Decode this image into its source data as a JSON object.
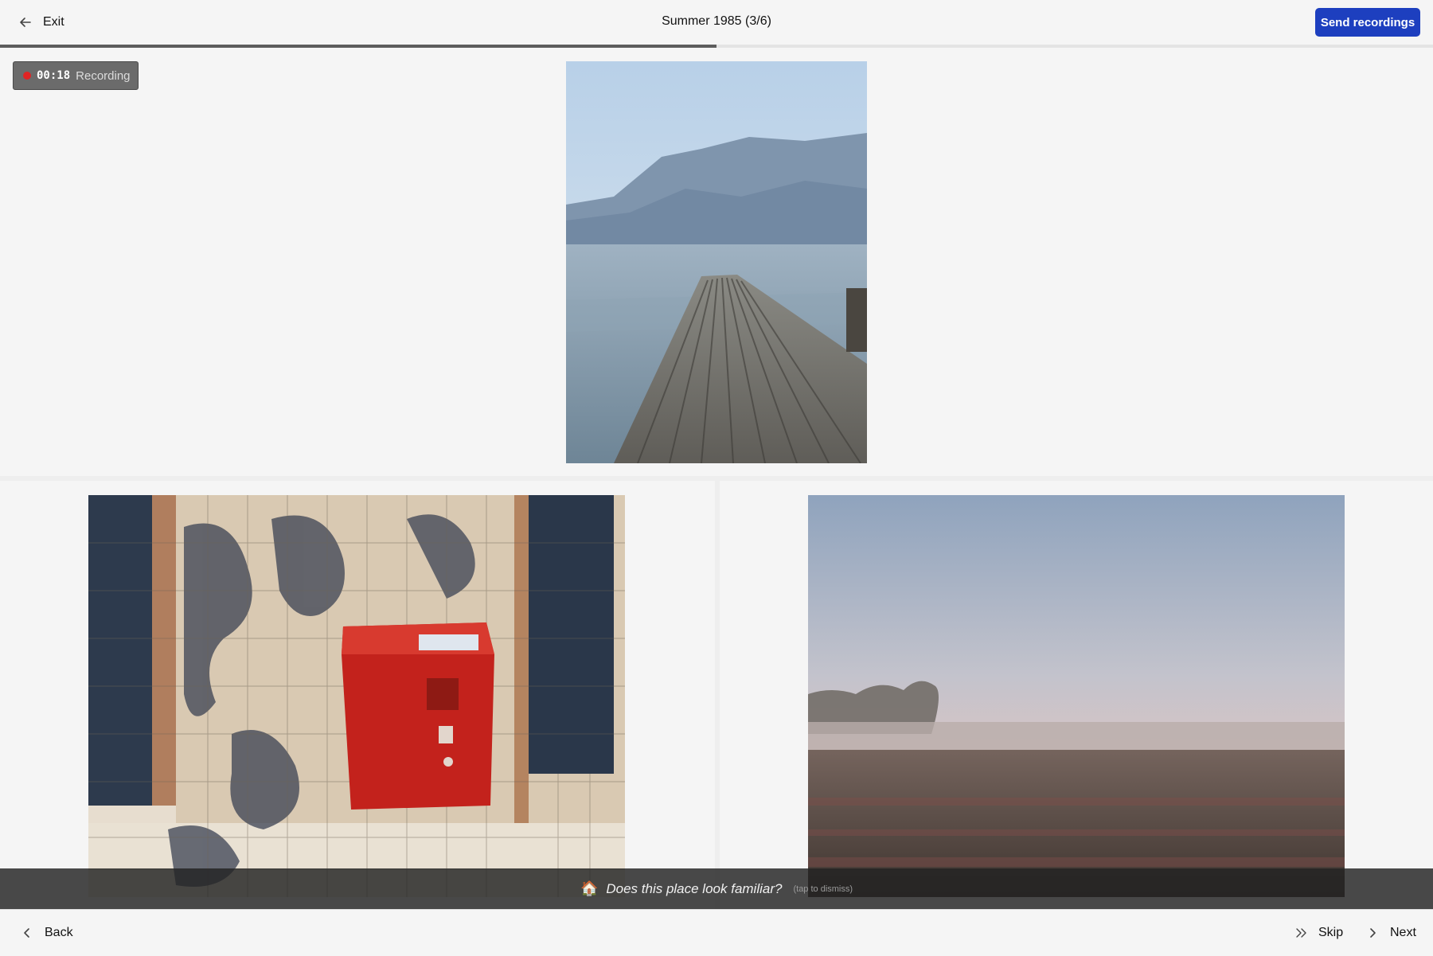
{
  "header": {
    "exit_label": "Exit",
    "title": "Summer 1985 (3/6)",
    "send_label": "Send recordings"
  },
  "progress": {
    "fraction": 0.5
  },
  "recording": {
    "time": "00:18",
    "label": "Recording",
    "indicator_color": "#e02424"
  },
  "photos": [
    {
      "description_name": "lake-dock-photo"
    },
    {
      "description_name": "red-mailbox-photo"
    },
    {
      "description_name": "misty-field-photo"
    }
  ],
  "prompt": {
    "icon": "🏠",
    "text": "Does this place look familiar?",
    "hint": "(tap to dismiss)"
  },
  "footer": {
    "back_label": "Back",
    "skip_label": "Skip",
    "next_label": "Next"
  },
  "colors": {
    "accent": "#1d3fbf",
    "background": "#f5f5f5"
  }
}
